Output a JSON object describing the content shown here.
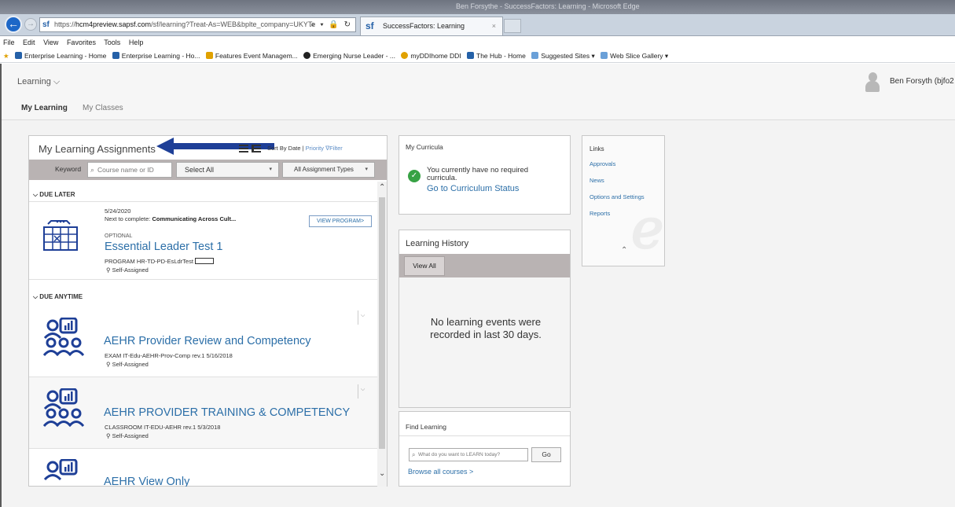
{
  "browser": {
    "window_title": "Ben Forsythe - SuccessFactors: Learning - Microsoft Edge",
    "address_prefix": "https://",
    "address_host": "hcm4preview.sapsf.com",
    "address_path": "/sf/learning?Treat-As=WEB&bplte_company=UKYTe",
    "address_controls": "⌕ ▾ 🔒 ↻",
    "tab_title": "SuccessFactors: Learning",
    "tab_logo": "sf",
    "address_logo": "sf",
    "tab_close": "×",
    "back_arrow": "←",
    "forward_arrow": "→",
    "menu": [
      "File",
      "Edit",
      "View",
      "Favorites",
      "Tools",
      "Help"
    ],
    "favorites": [
      {
        "label": "Enterprise Learning - Home",
        "color": "#2561a8"
      },
      {
        "label": "Enterprise Learning - Ho...",
        "color": "#2561a8"
      },
      {
        "label": "Features Event Managem...",
        "color": "#e0a100"
      },
      {
        "label": "Emerging Nurse Leader - ...",
        "color": "#222222"
      },
      {
        "label": "myDDIhome DDI",
        "color": "#e0a100"
      },
      {
        "label": "The Hub - Home",
        "color": "#2561a8"
      },
      {
        "label": "Suggested Sites ▾",
        "color": "#6aa0d8"
      },
      {
        "label": "Web Slice Gallery ▾",
        "color": "#6aa0d8"
      }
    ]
  },
  "header": {
    "learning_menu": "Learning ⌵",
    "user_name": "Ben Forsyth (bjfo2",
    "subnav_active": "My Learning",
    "subnav_other": "My Classes"
  },
  "assignments": {
    "title": "My Learning Assignments",
    "sort_prefix": "Sort By Date |",
    "sort_priority": "Priority",
    "filter_label": "Filter",
    "filter_icon": "∇",
    "keyword_label": "Keyword",
    "keyword_placeholder": "Course name or ID",
    "select_all": "Select All",
    "assignment_types": "All Assignment Types",
    "caret": "▾",
    "scroll_up": "⌃",
    "scroll_down": "⌄",
    "sections": {
      "due_later": "⌵ DUE LATER",
      "due_anytime": "⌵ DUE ANYTIME"
    },
    "items": [
      {
        "date": "5/24/2020",
        "next_prefix": "Next to complete: ",
        "next_course": "Communicating Across Cult...",
        "optional": "OPTIONAL",
        "title": "Essential Leader Test 1",
        "meta": "PROGRAM HR-TD-PD-EsLdrTest",
        "assigned": "Self-Assigned",
        "action": "VIEW PROGRAM>"
      },
      {
        "title": "AEHR Provider Review and Competency",
        "meta": "EXAM IT-Edu-AEHR-Prov-Comp rev.1 5/16/2018",
        "assigned": "Self-Assigned",
        "menu": "⌵"
      },
      {
        "title": "AEHR PROVIDER TRAINING & COMPETENCY",
        "meta": "CLASSROOM IT-EDU-AEHR rev.1 5/3/2018",
        "assigned": "Self-Assigned",
        "menu": "⌵"
      },
      {
        "title": "AEHR View Only"
      }
    ],
    "person_glyph": "♁"
  },
  "curricula": {
    "title": "My Curricula",
    "message": "You currently have no required curricula.",
    "link": "Go to Curriculum Status",
    "check": "✓"
  },
  "history": {
    "title": "Learning History",
    "view_all": "View All",
    "empty": "No learning events were recorded in last 30 days."
  },
  "find": {
    "title": "Find Learning",
    "placeholder": "What do you want to LEARN today?",
    "go": "Go",
    "browse": "Browse all courses >",
    "search_glyph": "⌕"
  },
  "links": {
    "title": "Links",
    "items": [
      "Approvals",
      "News",
      "Options and Settings",
      "Reports"
    ],
    "collapse": "⌃"
  }
}
